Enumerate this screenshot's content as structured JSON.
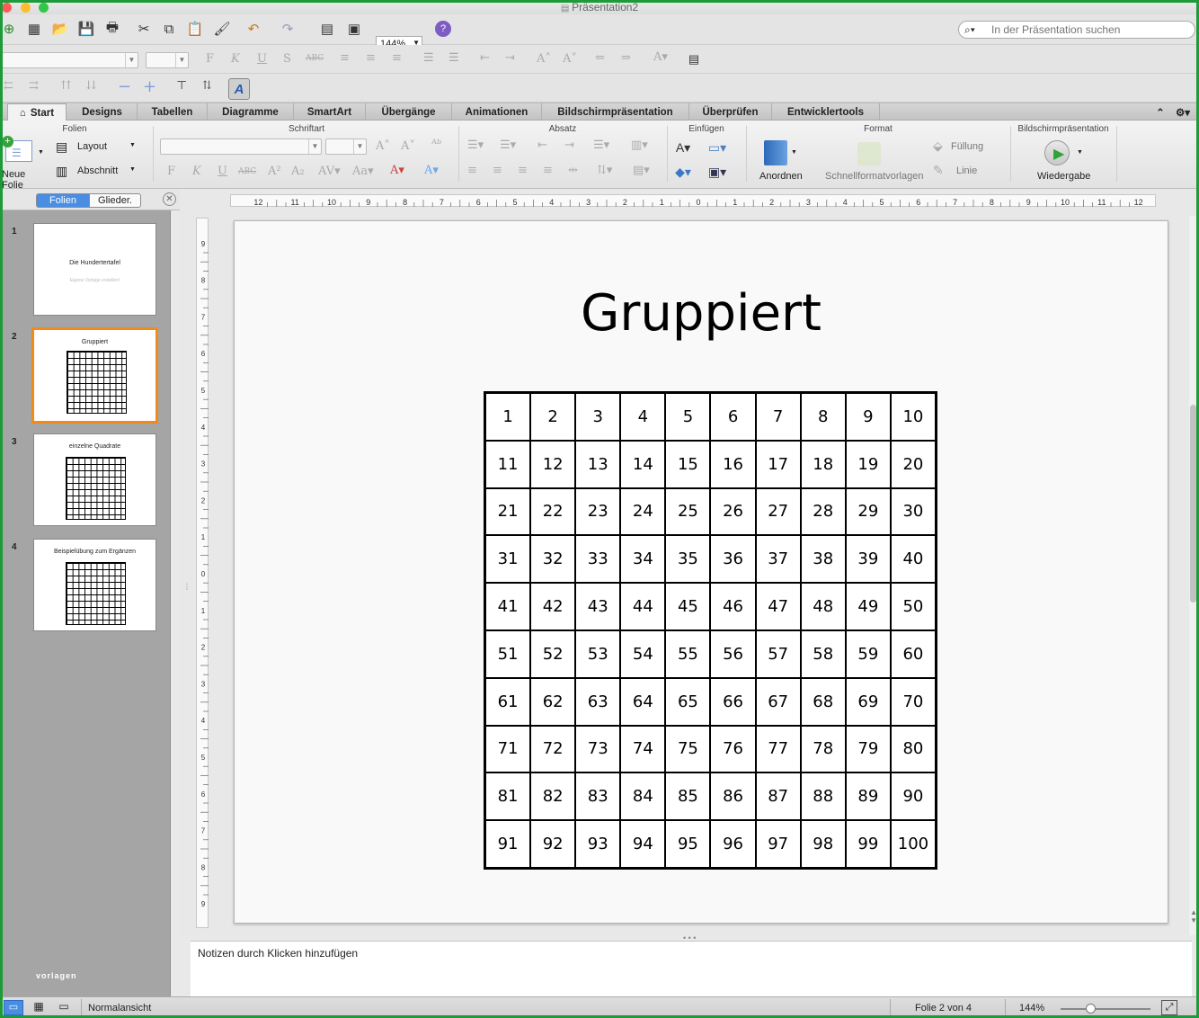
{
  "window": {
    "title": "Präsentation2"
  },
  "toolbar": {
    "zoom": "144%",
    "search_placeholder": "In der Präsentation suchen"
  },
  "tabs": [
    "Start",
    "Designs",
    "Tabellen",
    "Diagramme",
    "SmartArt",
    "Übergänge",
    "Animationen",
    "Bildschirmpräsentation",
    "Überprüfen",
    "Entwicklertools"
  ],
  "ribbon": {
    "groups": {
      "folien": "Folien",
      "schriftart": "Schriftart",
      "absatz": "Absatz",
      "einfuegen": "Einfügen",
      "format": "Format",
      "bildschirm": "Bildschirmpräsentation"
    },
    "neue_folie": "Neue Folie",
    "layout": "Layout",
    "abschnitt": "Abschnitt",
    "anordnen": "Anordnen",
    "schnellformat": "Schnellformatvorlagen",
    "fuellung": "Füllung",
    "linie": "Linie",
    "wiedergabe": "Wiedergabe"
  },
  "leftpane": {
    "tab_folien": "Folien",
    "tab_glieder": "Glieder.",
    "watermark": "vorlagen",
    "slides": [
      {
        "num": "1",
        "title": "Die Hundertertafel",
        "subtitle": "Eigene Vorlage erstellen!"
      },
      {
        "num": "2",
        "title": "Gruppiert"
      },
      {
        "num": "3",
        "title": "einzelne Quadrate"
      },
      {
        "num": "4",
        "title": "Beispielübung zum Ergänzen"
      }
    ]
  },
  "slide": {
    "title": "Gruppiert",
    "grid_size": 10
  },
  "notes": {
    "placeholder": "Notizen durch Klicken hinzufügen"
  },
  "status": {
    "view": "Normalansicht",
    "slide_info": "Folie 2 von 4",
    "zoom": "144%"
  },
  "colors": {
    "frame": "#1d9b3a",
    "selection": "#f08a1a",
    "search_active": "#1f7fd6"
  }
}
